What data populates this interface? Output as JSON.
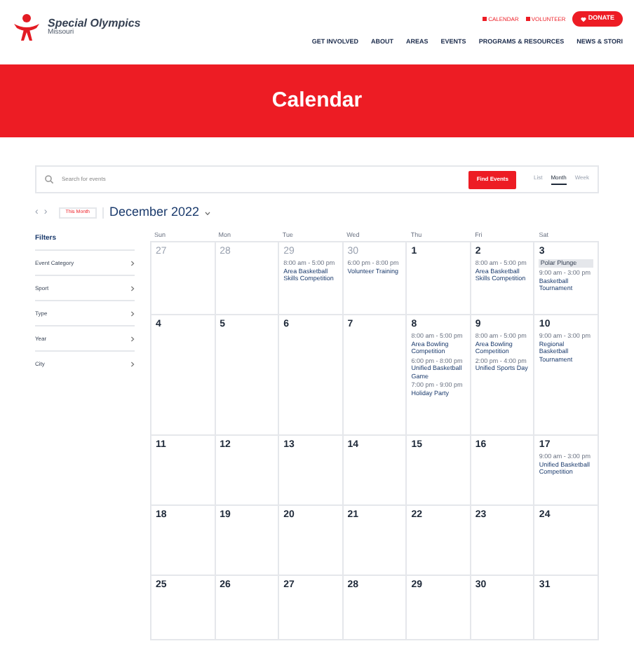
{
  "header": {
    "logo_name": "Special Olympics",
    "logo_region": "Missouri",
    "utility_links": [
      {
        "label": "CALENDAR"
      },
      {
        "label": "VOLUNTEER"
      }
    ],
    "donate": "DONATE",
    "nav": [
      "GET INVOLVED",
      "ABOUT",
      "AREAS",
      "EVENTS",
      "PROGRAMS & RESOURCES",
      "NEWS & STORI"
    ]
  },
  "banner": {
    "title": "Calendar"
  },
  "search": {
    "placeholder": "Search for events",
    "button": "Find Events",
    "views": [
      {
        "label": "List",
        "selected": false
      },
      {
        "label": "Month",
        "selected": true
      },
      {
        "label": "Week",
        "selected": false
      }
    ]
  },
  "toolbar": {
    "prev": "‹",
    "next": "›",
    "today": "This Month",
    "month": "December 2022"
  },
  "filters": {
    "title": "Filters",
    "items": [
      "Event Category",
      "Sport",
      "Type",
      "Year",
      "City"
    ]
  },
  "weekdays": [
    "Sun",
    "Mon",
    "Tue",
    "Wed",
    "Thu",
    "Fri",
    "Sat"
  ],
  "weeks": [
    [
      {
        "date": "27",
        "other_month": true
      },
      {
        "date": "28",
        "other_month": true
      },
      {
        "date": "29",
        "other_month": true,
        "events": [
          {
            "kind": "timed",
            "time": "8:00 am - 5:00 pm",
            "title": "Area Basketball Skills Competition"
          }
        ]
      },
      {
        "date": "30",
        "other_month": true,
        "events": [
          {
            "kind": "timed",
            "time": "6:00 pm - 8:00 pm",
            "title": "Volunteer Training"
          }
        ]
      },
      {
        "date": "1",
        "other_month": false
      },
      {
        "date": "2",
        "other_month": false,
        "events": [
          {
            "kind": "timed",
            "time": "8:00 am - 5:00 pm",
            "title": "Area Basketball Skills Competition"
          }
        ]
      },
      {
        "date": "3",
        "other_month": false,
        "events": [
          {
            "kind": "allday",
            "title": "Polar Plunge"
          },
          {
            "kind": "timed",
            "time": "9:00 am - 3:00 pm",
            "title": "Basketball Tournament"
          }
        ]
      }
    ],
    [
      {
        "date": "4",
        "other_month": false
      },
      {
        "date": "5",
        "other_month": false
      },
      {
        "date": "6",
        "other_month": false
      },
      {
        "date": "7",
        "other_month": false
      },
      {
        "date": "8",
        "other_month": false,
        "events": [
          {
            "kind": "timed",
            "time": "8:00 am - 5:00 pm",
            "title": "Area Bowling Competition"
          },
          {
            "kind": "timed",
            "time": "6:00 pm - 8:00 pm",
            "title": "Unified Basketball Game"
          },
          {
            "kind": "timed",
            "time": "7:00 pm - 9:00 pm",
            "title": "Holiday Party"
          }
        ]
      },
      {
        "date": "9",
        "other_month": false,
        "events": [
          {
            "kind": "timed",
            "time": "8:00 am - 5:00 pm",
            "title": "Area Bowling Competition"
          },
          {
            "kind": "timed",
            "time": "2:00 pm - 4:00 pm",
            "title": "Unified Sports Day"
          }
        ]
      },
      {
        "date": "10",
        "other_month": false,
        "events": [
          {
            "kind": "timed",
            "time": "9:00 am - 3:00 pm",
            "title": "Regional Basketball Tournament"
          }
        ]
      }
    ],
    [
      {
        "date": "11",
        "other_month": false
      },
      {
        "date": "12",
        "other_month": false
      },
      {
        "date": "13",
        "other_month": false
      },
      {
        "date": "14",
        "other_month": false
      },
      {
        "date": "15",
        "other_month": false
      },
      {
        "date": "16",
        "other_month": false
      },
      {
        "date": "17",
        "other_month": false,
        "events": [
          {
            "kind": "timed",
            "time": "9:00 am - 3:00 pm",
            "title": "Unified Basketball Competition"
          }
        ]
      }
    ],
    [
      {
        "date": "18",
        "other_month": false
      },
      {
        "date": "19",
        "other_month": false
      },
      {
        "date": "20",
        "other_month": false
      },
      {
        "date": "21",
        "other_month": false
      },
      {
        "date": "22",
        "other_month": false
      },
      {
        "date": "23",
        "other_month": false
      },
      {
        "date": "24",
        "other_month": false
      }
    ],
    [
      {
        "date": "25",
        "other_month": false
      },
      {
        "date": "26",
        "other_month": false
      },
      {
        "date": "27",
        "other_month": false
      },
      {
        "date": "28",
        "other_month": false
      },
      {
        "date": "29",
        "other_month": false
      },
      {
        "date": "30",
        "other_month": false
      },
      {
        "date": "31",
        "other_month": false
      }
    ]
  ]
}
